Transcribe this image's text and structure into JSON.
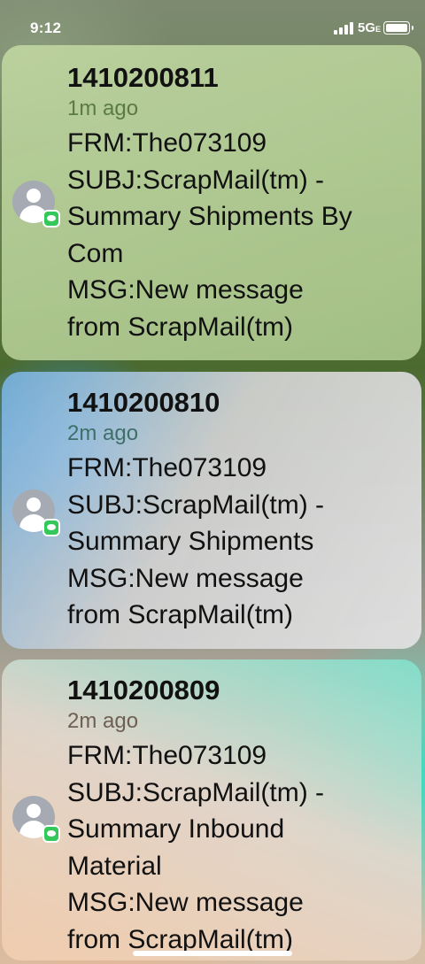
{
  "status_bar": {
    "time": "9:12",
    "network": "5G",
    "network_suffix": "E",
    "icons": [
      "signal-bars-icon",
      "battery-icon"
    ]
  },
  "notifications": [
    {
      "sender": "1410200811",
      "time": "1m ago",
      "lines": [
        "FRM:The073109",
        "SUBJ:ScrapMail(tm) -",
        "Summary Shipments By",
        "Com",
        "MSG:New message",
        "from ScrapMail(tm)"
      ],
      "icon": "contact-avatar-icon",
      "app_badge": "messages-app-icon"
    },
    {
      "sender": "1410200810",
      "time": "2m ago",
      "lines": [
        "FRM:The073109",
        "SUBJ:ScrapMail(tm) -",
        "Summary Shipments",
        "MSG:New message",
        "from ScrapMail(tm)"
      ],
      "icon": "contact-avatar-icon",
      "app_badge": "messages-app-icon"
    },
    {
      "sender": "1410200809",
      "time": "2m ago",
      "lines": [
        "FRM:The073109",
        "SUBJ:ScrapMail(tm) -",
        "Summary Inbound",
        "Material",
        "MSG:New message",
        "from ScrapMail(tm)"
      ],
      "icon": "contact-avatar-icon",
      "app_badge": "messages-app-icon"
    }
  ],
  "colors": {
    "messages_green": "#34c759"
  }
}
